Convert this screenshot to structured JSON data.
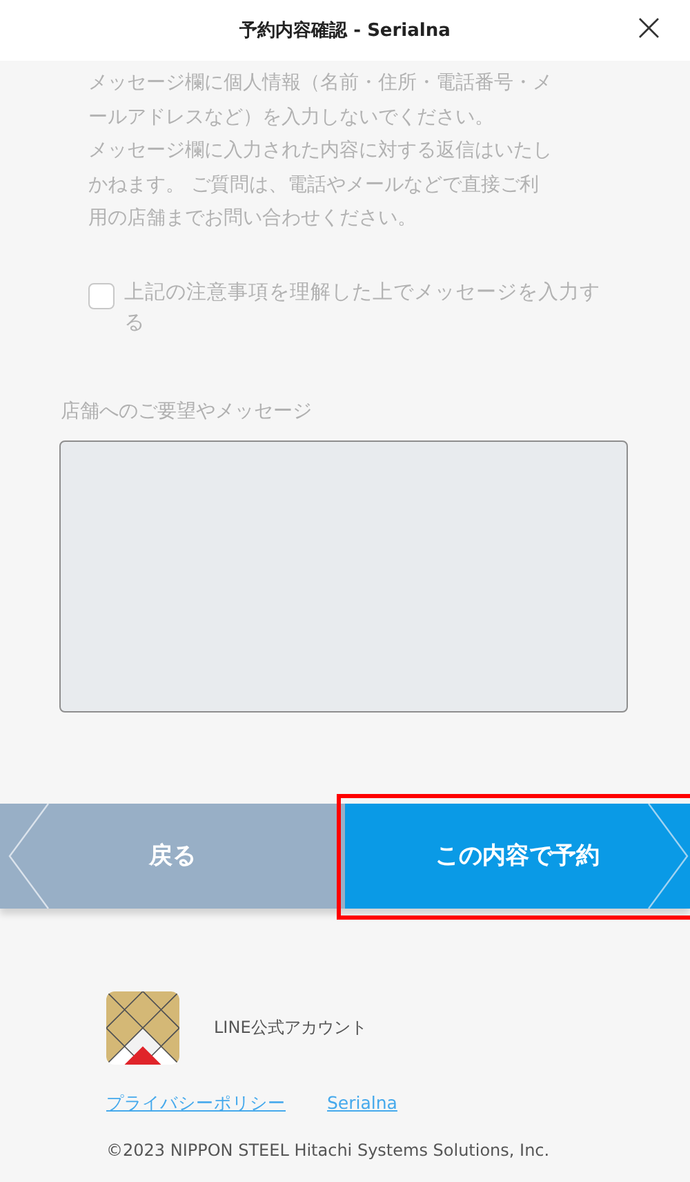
{
  "header": {
    "title": "予約内容確認 - Serialna",
    "close": "×"
  },
  "notice": [
    "メッセージ欄に個人情報（名前・住所・電話番号・メールアドレスなど）を入力しないでください。",
    "メッセージ欄に入力された内容に対する返信はいたしかねます。 ご質問は、電話やメールなどで直接ご利用の店舗までお問い合わせください。"
  ],
  "agreement": {
    "label": "上記の注意事項を理解した上でメッセージを入力する",
    "checked": false
  },
  "message": {
    "label": "店舗へのご要望やメッセージ",
    "disabled": true
  },
  "buttons": [
    {
      "kind": "back",
      "label": "戻る",
      "highlighted": false
    },
    {
      "kind": "submit",
      "label": "この内容で予約",
      "highlighted": true
    }
  ],
  "footer": {
    "account": "LINE公式アカウント",
    "links": [
      "プライバシーポリシー",
      "Serialna"
    ],
    "copyright": "©2023 NIPPON STEEL Hitachi Systems Solutions, Inc."
  }
}
